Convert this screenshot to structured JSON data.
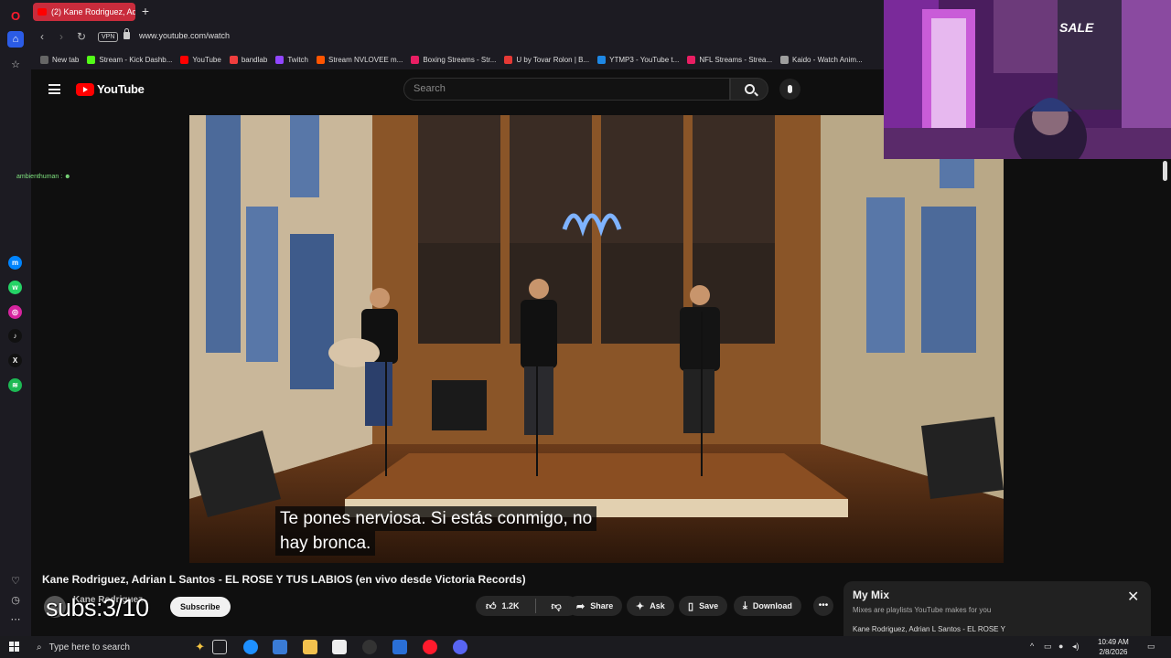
{
  "browser": {
    "tab_title": "(2) Kane Rodriguez, Adria",
    "new_tab_symbol": "+",
    "vpn_label": "VPN",
    "url": "www.youtube.com/watch",
    "bookmarks": [
      {
        "label": "New tab",
        "color": "#666666"
      },
      {
        "label": "Stream - Kick Dashb...",
        "color": "#53fc18"
      },
      {
        "label": "YouTube",
        "color": "#ff0000"
      },
      {
        "label": "bandlab",
        "color": "#f03e3e"
      },
      {
        "label": "Twitch",
        "color": "#9146ff"
      },
      {
        "label": "Stream NVLOVEE m...",
        "color": "#ff5500"
      },
      {
        "label": "Boxing Streams - Str...",
        "color": "#e91e63"
      },
      {
        "label": "U by Tovar Rolon | B...",
        "color": "#e53935"
      },
      {
        "label": "YTMP3 - YouTube t...",
        "color": "#1e88e5"
      },
      {
        "label": "NFL Streams - Strea...",
        "color": "#e91e63"
      },
      {
        "label": "Kaido - Watch Anim...",
        "color": "#9e9e9e"
      }
    ]
  },
  "youtube": {
    "logo_text": "YouTube",
    "search_placeholder": "Search"
  },
  "chat": {
    "message": "ambienthuman : ☻"
  },
  "video": {
    "subtitle_line1": "Te pones nerviosa. Si estás conmigo, no",
    "subtitle_line2": "hay bronca."
  },
  "watch": {
    "title": "Kane Rodriguez, Adrian L Santos - EL ROSE Y TUS LABIOS (en vivo desde Victoria Records)",
    "channel_name": "Kane Rodriguez",
    "overlay_text": "subs:3/10",
    "subscribe_label": "Subscribe",
    "like_count": "1.2K",
    "share_label": "Share",
    "ask_label": "Ask",
    "save_label": "Save",
    "download_label": "Download",
    "more_label": "•••"
  },
  "mymix": {
    "title": "My Mix",
    "subtitle": "Mixes are playlists YouTube makes for you",
    "close": "✕",
    "first_item": "Kane Rodriguez, Adrian L Santos - EL ROSE Y"
  },
  "webcam": {
    "wall_text": "SALE"
  },
  "taskbar": {
    "search_placeholder": "Type here to search",
    "time": "10:49 AM",
    "date": "2/8/2026"
  }
}
